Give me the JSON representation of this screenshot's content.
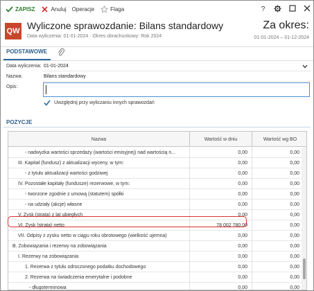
{
  "toolbar": {
    "save_label": "ZAPISZ",
    "cancel_label": "Anuluj",
    "operations_label": "Operacje",
    "flag_label": "Flaga"
  },
  "header": {
    "badge": "QW",
    "title": "Wyliczone sprawozdanie: Bilans standardowy",
    "subtitle": "Data wyliczenia: 01-01-2024 · Okres obrachunkowy: Rok 2024",
    "period_label": "Za okres:",
    "period_range": "01-01-2024 – 31-12-2024"
  },
  "tabs": {
    "main": "PODSTAWOWE"
  },
  "form": {
    "date_label": "Data wyliczenia:",
    "date_value": "01-01-2024",
    "name_label": "Nazwa:",
    "name_value": "Bilans standardowy",
    "desc_label": "Opis:",
    "desc_value": "",
    "checkbox_label": "Uwzględnij przy wyliczaniu innych sprawozdań",
    "checkbox_checked": true
  },
  "section": {
    "title": "POZYCJE"
  },
  "grid": {
    "columns": [
      "Nazwa",
      "Wartość w dniu",
      "Wartość wg BO"
    ],
    "rows": [
      {
        "name": "- nadwyżka wartości sprzedaży (wartości emisyjnej) nad wartością n...",
        "indent": 3,
        "value_day": "0,00",
        "value_bo": "0,00"
      },
      {
        "name": "III. Kapitał (fundusz) z aktualizacji wyceny, w tym:",
        "indent": 2,
        "value_day": "0,00",
        "value_bo": "0,00"
      },
      {
        "name": "- z tytułu aktualizacji wartości godziwej",
        "indent": 3,
        "value_day": "0,00",
        "value_bo": "0,00"
      },
      {
        "name": "IV. Pozostałe kapitały (fundusze) rezerwowe, w tym:",
        "indent": 2,
        "value_day": "0,00",
        "value_bo": "0,00"
      },
      {
        "name": "- tworzone zgodnie z umową (statutem) spółki",
        "indent": 3,
        "value_day": "0,00",
        "value_bo": "0,00"
      },
      {
        "name": "- na udziały (akcje) własne",
        "indent": 3,
        "value_day": "0,00",
        "value_bo": "0,00"
      },
      {
        "name": "V. Zysk (strata) z lat ubiegłych",
        "indent": 2,
        "value_day": "0,00",
        "value_bo": "0,00"
      },
      {
        "name": "VI. Zysk (strata) netto",
        "indent": 2,
        "value_day": "78 002 780,00",
        "value_bo": "0,00"
      },
      {
        "name": "VII. Odpisy z zysku netto w ciągu roku obrotowego (wielkość ujemna)",
        "indent": 2,
        "value_day": "0,00",
        "value_bo": "0,00"
      },
      {
        "name": "B. Zobowiązania i rezerwy na zobowiązania",
        "indent": 1,
        "value_day": "0,00",
        "value_bo": "0,00"
      },
      {
        "name": "I. Rezerwy na zobowiązania",
        "indent": 2,
        "value_day": "0,00",
        "value_bo": "0,00"
      },
      {
        "name": "1. Rezerwa z tytułu odroczonego podatku dochodowego",
        "indent": 3,
        "value_day": "0,00",
        "value_bo": "0,00"
      },
      {
        "name": "2. Rezerwa na świadczenia emerytalne i podobne",
        "indent": 3,
        "value_day": "0,00",
        "value_bo": "0,00"
      },
      {
        "name": "- długoterminowa",
        "indent": 4,
        "value_day": "0,00",
        "value_bo": "0,00"
      },
      {
        "name": "- krótkoterminowa",
        "indent": 4,
        "value_day": "0,00",
        "value_bo": "0,00"
      }
    ]
  },
  "colors": {
    "accent": "#2b5e8c",
    "badge": "#c8462f",
    "save": "#2d7d2d",
    "highlight": "#d9302a"
  }
}
